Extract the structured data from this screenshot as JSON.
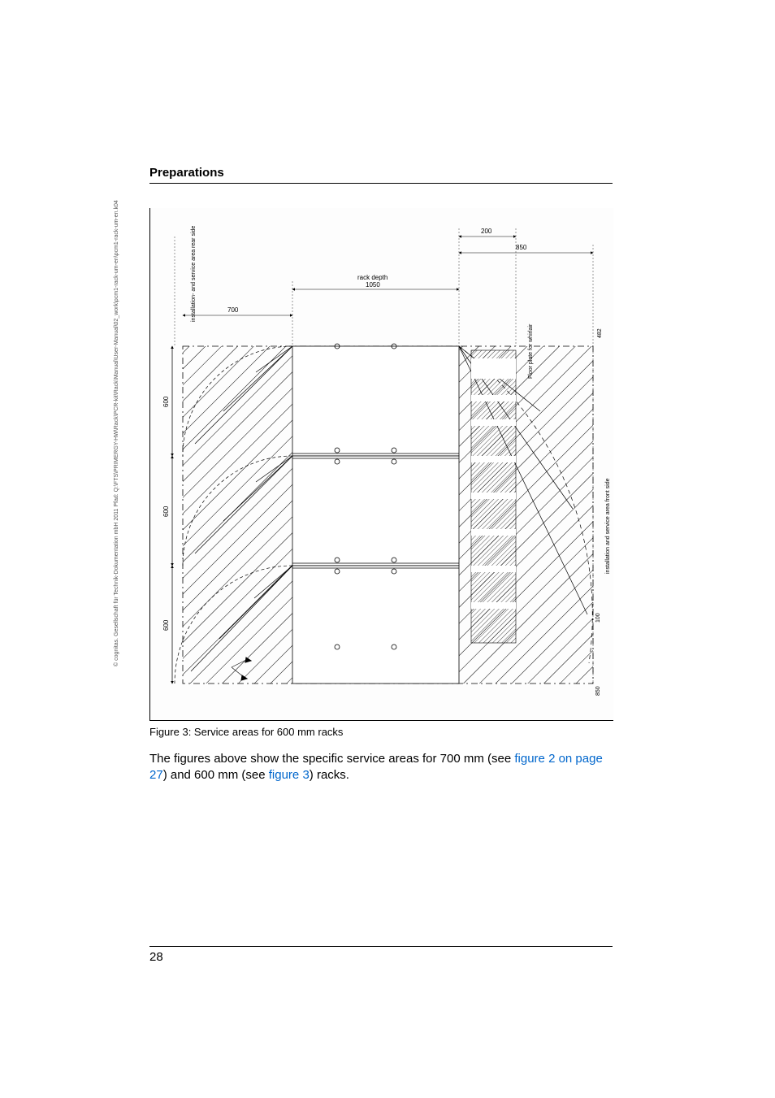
{
  "side_note": "© cognitas. Gesellschaft für Technik-Dokumentation mbH 2011     Pfad: Q:\\FTS\\PRIMERGY-HW\\Rack\\PCR-kit\\Rack\\Manual\\User-Manual\\02_work\\pcm1-rack-um-en\\pcm1-rack-um-en.k04",
  "section_title": "Preparations",
  "figure": {
    "caption": "Figure 3: Service areas for 600 mm racks",
    "labels": {
      "rack_depth_top": "rack depth",
      "rack_depth_val": "1050",
      "top_200": "200",
      "top_850": "850",
      "left_700": "700",
      "left_600_a": "600",
      "left_600_b": "600",
      "left_600_c": "600",
      "right_100": "100",
      "right_850": "850",
      "right_482": "482",
      "right_side_label": "installation and service area front side",
      "left_side_label": "installation- and service area rear side",
      "floor_plate_label": "Floor plate for whirlair"
    }
  },
  "body": {
    "pre": "The figures above show the specific service areas for 700 mm (see ",
    "link1": "figure 2 on page 27",
    "mid": ") and 600 mm (see ",
    "link2": "figure 3",
    "post": ") racks."
  },
  "page_number": "28"
}
